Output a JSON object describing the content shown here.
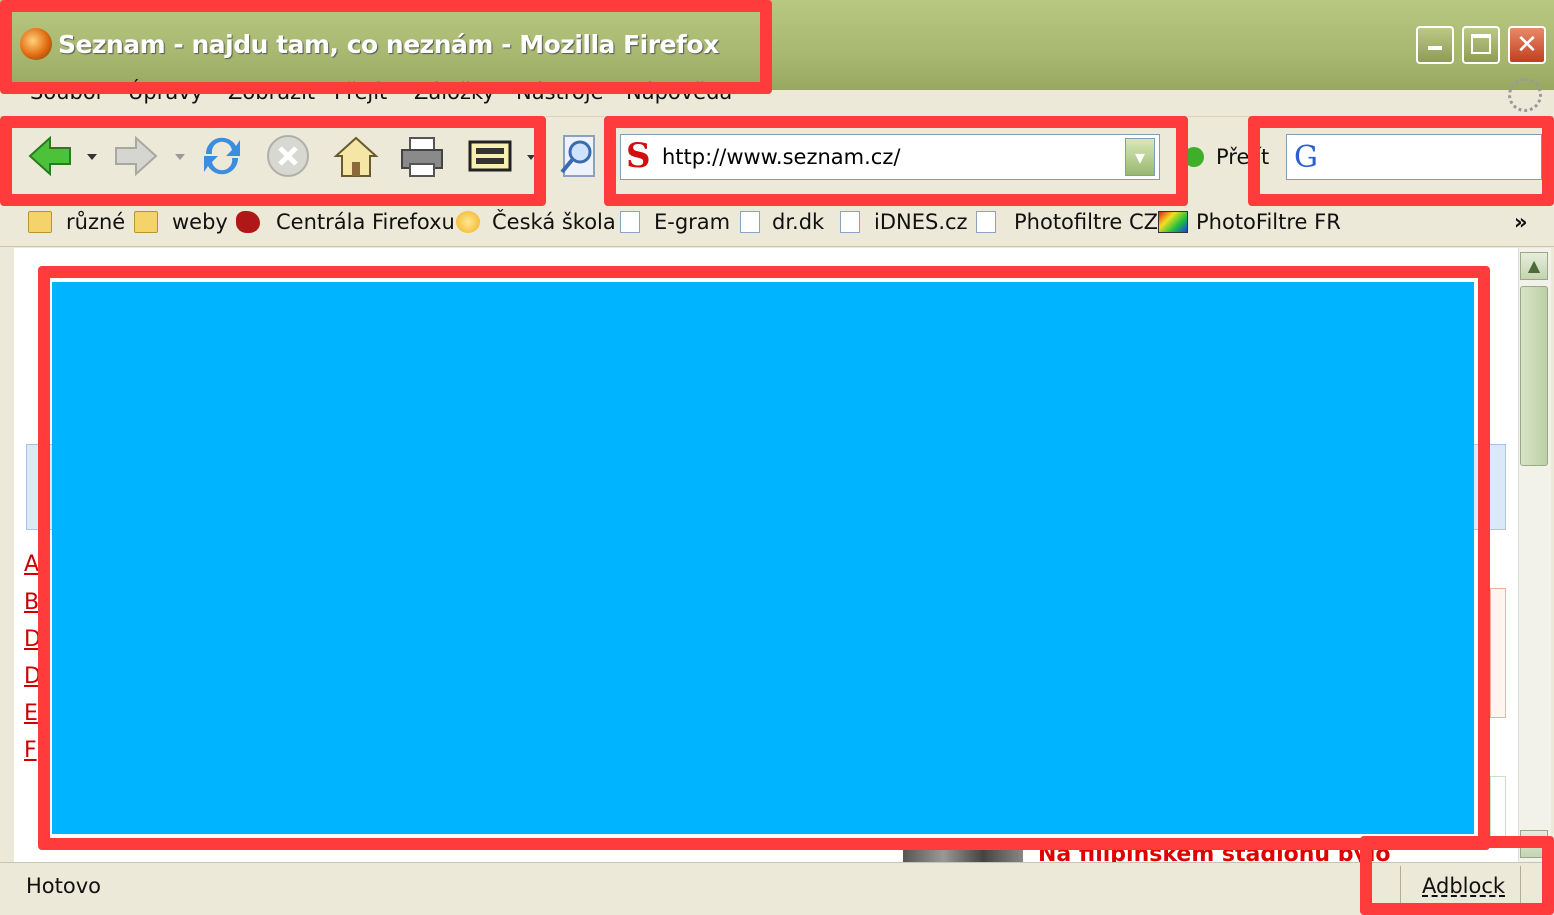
{
  "window": {
    "title": "Seznam - najdu tam, co neznám - Mozilla Firefox"
  },
  "menu": [
    "Soubor",
    "Úpravy",
    "Zobrazit",
    "Přejít",
    "Záložky",
    "Nástroje",
    "Nápověda"
  ],
  "toolbar": {
    "icons": [
      "back-arrow-icon",
      "dropdown-arrow-icon",
      "forward-arrow-icon",
      "reload-icon",
      "stop-icon",
      "home-icon",
      "print-icon",
      "screenshot-icon",
      "magnifier-icon"
    ],
    "url": "http://www.seznam.cz/",
    "go_label": "Přejít",
    "search_engine_icon": "google-icon"
  },
  "bookmarks": [
    {
      "label": "různé",
      "icon": "folder-icon"
    },
    {
      "label": "weby",
      "icon": "folder-icon"
    },
    {
      "label": "Centrála Firefoxu",
      "icon": "firefox-bug-icon"
    },
    {
      "label": "Česká škola",
      "icon": "bulb-icon"
    },
    {
      "label": "E-gram",
      "icon": "page-icon"
    },
    {
      "label": "dr.dk",
      "icon": "page-icon"
    },
    {
      "label": "iDNES.cz",
      "icon": "page-icon"
    },
    {
      "label": "Photofiltre CZ",
      "icon": "page-icon"
    },
    {
      "label": "PhotoFiltre FR",
      "icon": "photofiltre-icon"
    }
  ],
  "bookmarks_more": "»",
  "content": {
    "side_links": [
      "A",
      "B",
      "D",
      "D",
      "E",
      "F"
    ],
    "headline": "Na filipínském stadionu bylo"
  },
  "status": {
    "text": "Hotovo",
    "adblock": "Adblock"
  },
  "colors": {
    "highlight": "#ff3b3b",
    "redaction": "#00b4ff",
    "titlebar": "#a8b870"
  }
}
